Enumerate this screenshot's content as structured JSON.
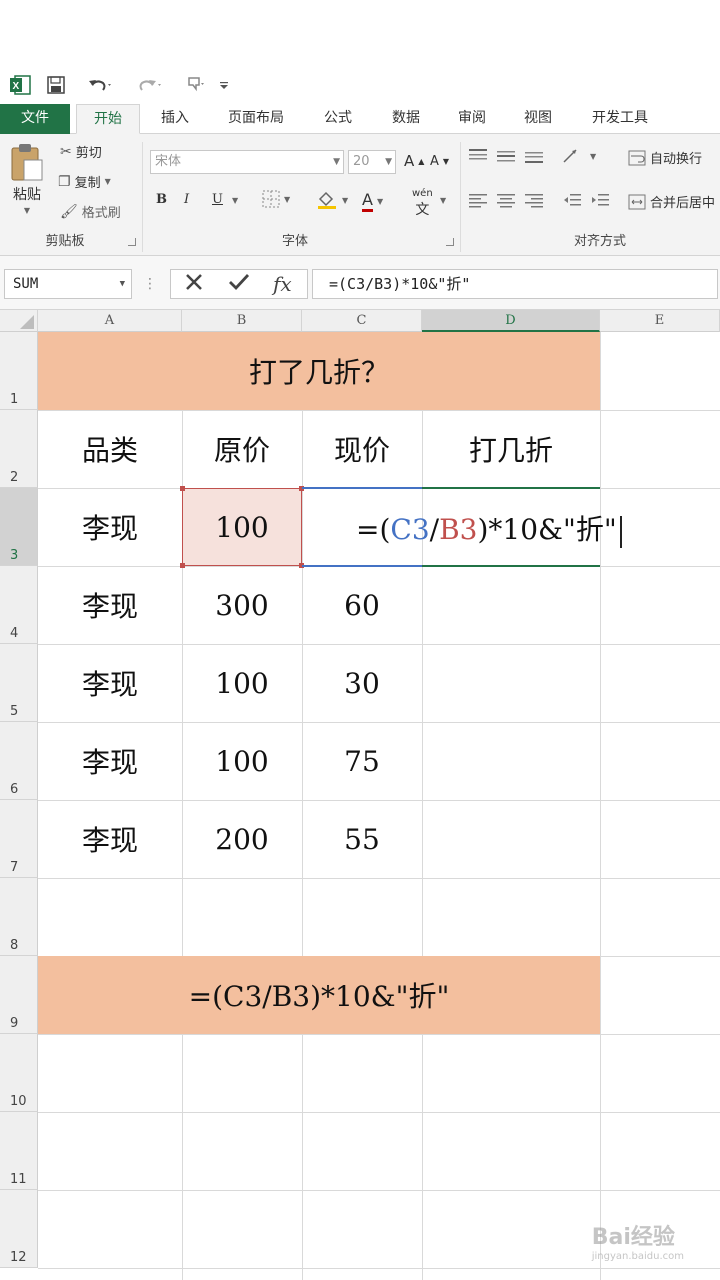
{
  "qat": {
    "excel_icon": "excel-logo-icon",
    "save_icon": "save-icon",
    "undo_icon": "undo-icon",
    "redo_icon": "redo-icon",
    "touch_icon": "touch-mode-icon",
    "customize_icon": "customize-qat-icon"
  },
  "tabs": [
    {
      "label": "文件"
    },
    {
      "label": "开始"
    },
    {
      "label": "插入"
    },
    {
      "label": "页面布局"
    },
    {
      "label": "公式"
    },
    {
      "label": "数据"
    },
    {
      "label": "审阅"
    },
    {
      "label": "视图"
    },
    {
      "label": "开发工具"
    }
  ],
  "ribbon": {
    "clipboard": {
      "paste_label": "粘贴",
      "cut_label": "剪切",
      "copy_label": "复制",
      "format_painter_label": "格式刷",
      "group_label": "剪贴板"
    },
    "font": {
      "font_name": "宋体",
      "font_size": "20",
      "grow_label": "A",
      "shrink_label": "A",
      "bold": "B",
      "italic": "I",
      "underline": "U",
      "font_color_label": "A",
      "phonetic_label": "wén",
      "group_label": "字体"
    },
    "alignment": {
      "wrap_text_label": "自动换行",
      "merge_center_label": "合并后居中",
      "group_label": "对齐方式"
    }
  },
  "formula_bar": {
    "name_box": "SUM",
    "cancel_icon": "cancel-icon",
    "enter_icon": "enter-check-icon",
    "fx_label": "fx",
    "formula": "=(C3/B3)*10&\"折\""
  },
  "grid": {
    "columns": [
      "A",
      "B",
      "C",
      "D",
      "E"
    ],
    "rows": [
      "1",
      "2",
      "3",
      "4",
      "5",
      "6",
      "7",
      "8",
      "9",
      "10",
      "11",
      "12"
    ],
    "title": "打了几折？",
    "headers": [
      "品类",
      "原价",
      "现价",
      "打几折"
    ],
    "data_rows": [
      {
        "category": "李现",
        "original": "100",
        "current": ""
      },
      {
        "category": "李现",
        "original": "300",
        "current": "60"
      },
      {
        "category": "李现",
        "original": "100",
        "current": "30"
      },
      {
        "category": "李现",
        "original": "100",
        "current": "75"
      },
      {
        "category": "李现",
        "original": "200",
        "current": "55"
      }
    ],
    "editing": {
      "prefix": "=(",
      "ref_c": "C3",
      "slash": "/",
      "ref_b": "B3",
      "suffix": ")*10&\"折\""
    },
    "formula_note": "=(C3/B3)*10&\"折\""
  },
  "colors": {
    "accent": "#217346",
    "title_fill": "#f3bf9e",
    "ref_c": "#4472c4",
    "ref_b": "#c0504d",
    "ref_b_fill": "#f6e1dc"
  },
  "watermark": {
    "brand": "Bai经验",
    "url": "jingyan.baidu.com"
  }
}
